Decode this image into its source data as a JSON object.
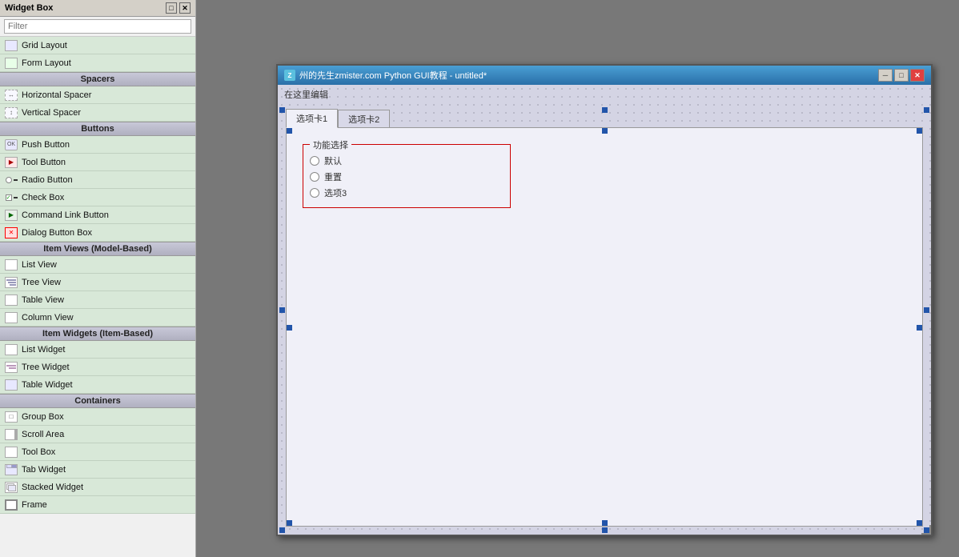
{
  "widget_box": {
    "title": "Widget Box",
    "filter_placeholder": "Filter",
    "titlebar_icons": [
      "□",
      "✕"
    ],
    "sections": [
      {
        "type": "category",
        "label": ""
      },
      {
        "type": "item",
        "label": "Grid Layout",
        "icon": "grid"
      },
      {
        "type": "item",
        "label": "Form Layout",
        "icon": "form"
      },
      {
        "type": "category",
        "label": "Spacers"
      },
      {
        "type": "item",
        "label": "Horizontal Spacer",
        "icon": "spacer-h"
      },
      {
        "type": "item",
        "label": "Vertical Spacer",
        "icon": "spacer-v"
      },
      {
        "type": "category",
        "label": "Buttons"
      },
      {
        "type": "item",
        "label": "Push Button",
        "icon": "push"
      },
      {
        "type": "item",
        "label": "Tool Button",
        "icon": "tool"
      },
      {
        "type": "item",
        "label": "Radio Button",
        "icon": "radio"
      },
      {
        "type": "item",
        "label": "Check Box",
        "icon": "check"
      },
      {
        "type": "item",
        "label": "Command Link Button",
        "icon": "cmd"
      },
      {
        "type": "item",
        "label": "Dialog Button Box",
        "icon": "dialog"
      },
      {
        "type": "category",
        "label": "Item Views (Model-Based)"
      },
      {
        "type": "item",
        "label": "List View",
        "icon": "list"
      },
      {
        "type": "item",
        "label": "Tree View",
        "icon": "tree"
      },
      {
        "type": "item",
        "label": "Table View",
        "icon": "table"
      },
      {
        "type": "item",
        "label": "Column View",
        "icon": "col"
      },
      {
        "type": "category",
        "label": "Item Widgets (Item-Based)"
      },
      {
        "type": "item",
        "label": "List Widget",
        "icon": "lw"
      },
      {
        "type": "item",
        "label": "Tree Widget",
        "icon": "tw"
      },
      {
        "type": "item",
        "label": "Table Widget",
        "icon": "tabw"
      },
      {
        "type": "category",
        "label": "Containers"
      },
      {
        "type": "item",
        "label": "Group Box",
        "icon": "group"
      },
      {
        "type": "item",
        "label": "Scroll Area",
        "icon": "scroll"
      },
      {
        "type": "item",
        "label": "Tool Box",
        "icon": "toolbox"
      },
      {
        "type": "item",
        "label": "Tab Widget",
        "icon": "tabwidget"
      },
      {
        "type": "item",
        "label": "Stacked Widget",
        "icon": "stacked"
      },
      {
        "type": "item",
        "label": "Frame",
        "icon": "frame"
      }
    ]
  },
  "qt_window": {
    "title": "州的先生zmister.com Python GUI教程 - untitled*",
    "title_icon": "Z",
    "edit_field": "在这里编辑",
    "tabs": [
      {
        "label": "选项卡1",
        "active": true
      },
      {
        "label": "选项卡2",
        "active": false
      }
    ],
    "group_box": {
      "title": "功能选择",
      "options": [
        {
          "label": "默认",
          "selected": false
        },
        {
          "label": "重置",
          "selected": false
        },
        {
          "label": "选项3",
          "selected": false
        }
      ]
    }
  }
}
